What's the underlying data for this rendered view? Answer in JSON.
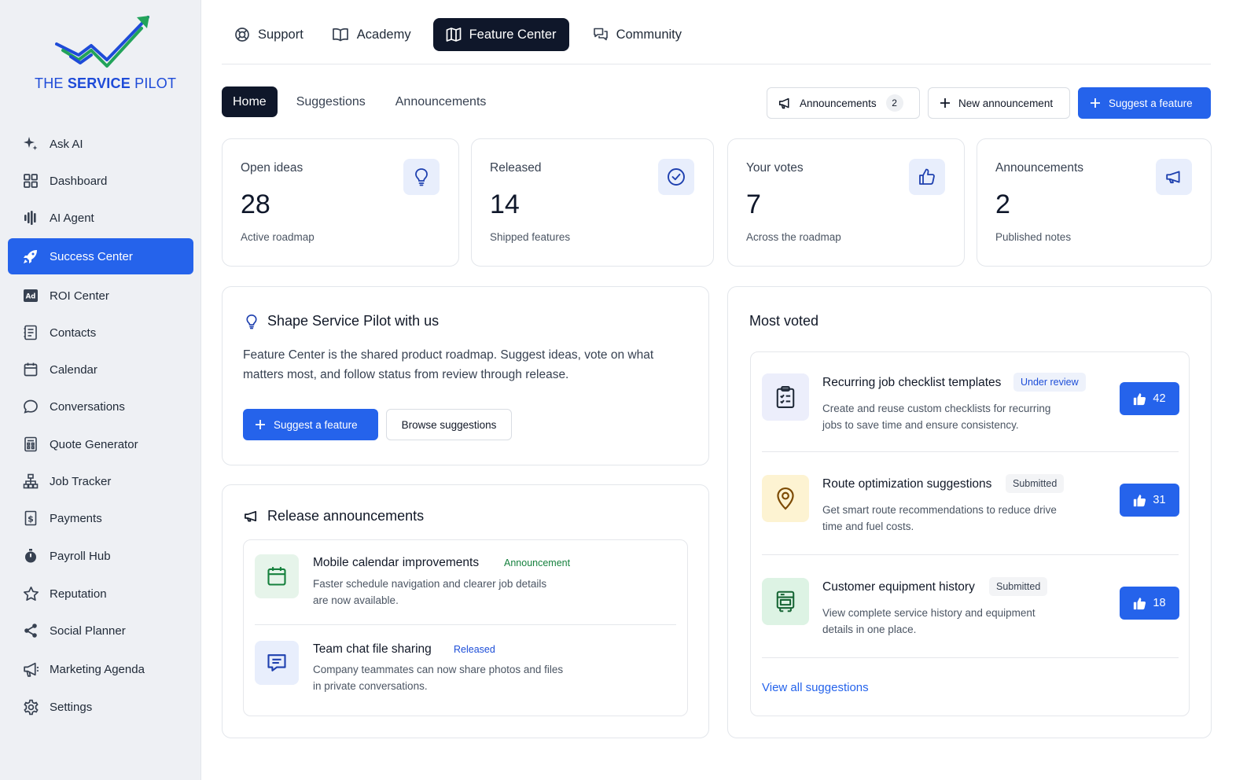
{
  "brand": {
    "name_prefix": "THE ",
    "name_strong": "SERVICE",
    "name_suffix": " PILOT",
    "color": "#1e4bd8"
  },
  "sidebar": {
    "items": [
      {
        "label": "Ask AI",
        "icon": "sparkle-icon"
      },
      {
        "label": "Dashboard",
        "icon": "grid-icon"
      },
      {
        "label": "AI Agent",
        "icon": "voice-icon"
      },
      {
        "label": "Success Center",
        "icon": "rocket-icon",
        "active": true
      },
      {
        "label": "ROI Center",
        "icon": "ad-icon"
      },
      {
        "label": "Contacts",
        "icon": "contacts-icon"
      },
      {
        "label": "Calendar",
        "icon": "calendar-icon"
      },
      {
        "label": "Conversations",
        "icon": "chat-icon"
      },
      {
        "label": "Quote Generator",
        "icon": "quote-icon"
      },
      {
        "label": "Job Tracker",
        "icon": "tracker-icon"
      },
      {
        "label": "Payments",
        "icon": "dollar-icon"
      },
      {
        "label": "Payroll Hub",
        "icon": "stopwatch-icon"
      },
      {
        "label": "Reputation",
        "icon": "star-icon"
      },
      {
        "label": "Social Planner",
        "icon": "share-icon"
      },
      {
        "label": "Marketing Agenda",
        "icon": "megaphone-icon"
      },
      {
        "label": "Settings",
        "icon": "gear-icon"
      }
    ]
  },
  "top_tabs": [
    {
      "label": "Support",
      "icon": "lifebuoy-icon"
    },
    {
      "label": "Academy",
      "icon": "book-icon"
    },
    {
      "label": "Feature Center",
      "icon": "map-icon",
      "active": true
    },
    {
      "label": "Community",
      "icon": "messages-icon"
    }
  ],
  "sub_tabs": [
    {
      "label": "Home",
      "active": true
    },
    {
      "label": "Suggestions"
    },
    {
      "label": "Announcements"
    }
  ],
  "actions": {
    "announcements_label": "Announcements",
    "announcements_count": "2",
    "new_announcement_label": "New announcement",
    "suggest_label": "Suggest a feature"
  },
  "stats": [
    {
      "label": "Open ideas",
      "value": "28",
      "sub": "Active roadmap",
      "icon": "lightbulb-icon"
    },
    {
      "label": "Released",
      "value": "14",
      "sub": "Shipped features",
      "icon": "check-circle-icon"
    },
    {
      "label": "Your votes",
      "value": "7",
      "sub": "Across the roadmap",
      "icon": "thumbs-up-icon"
    },
    {
      "label": "Announcements",
      "value": "2",
      "sub": "Published notes",
      "icon": "megaphone-icon"
    }
  ],
  "shape": {
    "title": "Shape Service Pilot with us",
    "body": "Feature Center is the shared product roadmap. Suggest ideas, vote on what matters most, and follow status from review through release.",
    "primary_label": "Suggest a feature",
    "secondary_label": "Browse suggestions"
  },
  "release": {
    "title": "Release announcements",
    "items": [
      {
        "title": "Mobile calendar improvements",
        "tag": "Announcement",
        "desc": "Faster schedule navigation and clearer job details are now available.",
        "icon": "calendar-icon"
      },
      {
        "title": "Team chat file sharing",
        "tag": "Released",
        "desc": "Company teammates can now share photos and files in private conversations.",
        "icon": "chat-icon"
      }
    ]
  },
  "most_voted": {
    "title": "Most voted",
    "items": [
      {
        "title": "Recurring job checklist templates",
        "tag": "Under review",
        "desc": "Create and reuse custom checklists for recurring jobs to save time and ensure consistency.",
        "votes": "42",
        "icon": "clipboard-icon"
      },
      {
        "title": "Route optimization suggestions",
        "tag": "Submitted",
        "desc": "Get smart route recommendations to reduce drive time and fuel costs.",
        "votes": "31",
        "icon": "map-pin-icon"
      },
      {
        "title": "Customer equipment history",
        "tag": "Submitted",
        "desc": "View complete service history and equipment details in one place.",
        "votes": "18",
        "icon": "equipment-icon"
      }
    ],
    "view_all_label": "View all suggestions"
  },
  "colors": {
    "accent": "#2563eb",
    "dark": "#0f172a",
    "announcement_tag": "#15803d",
    "released_tag": "#1d4ed8"
  }
}
